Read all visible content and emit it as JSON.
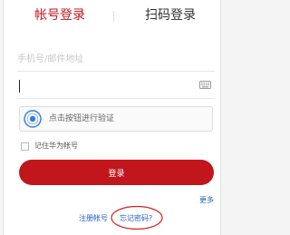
{
  "tabs": {
    "account_login": "帐号登录",
    "qr_login": "扫码登录"
  },
  "form": {
    "phone_placeholder": "手机号/邮件地址",
    "password_value": ""
  },
  "captcha": {
    "label": "点击按钮进行验证"
  },
  "remember": {
    "label": "记住华为帐号"
  },
  "login_button": {
    "label": "登录"
  },
  "links": {
    "more": "更多",
    "register": "注册帐号",
    "forgot_password": "忘记密码?"
  },
  "colors": {
    "accent_red": "#c0161c",
    "active_tab": "#c9151e",
    "link_blue": "#1f5fc8",
    "captcha_blue": "#2f7de1"
  },
  "icons": {
    "keyboard": "keyboard-icon",
    "captcha": "captcha-fingerprint-icon"
  }
}
